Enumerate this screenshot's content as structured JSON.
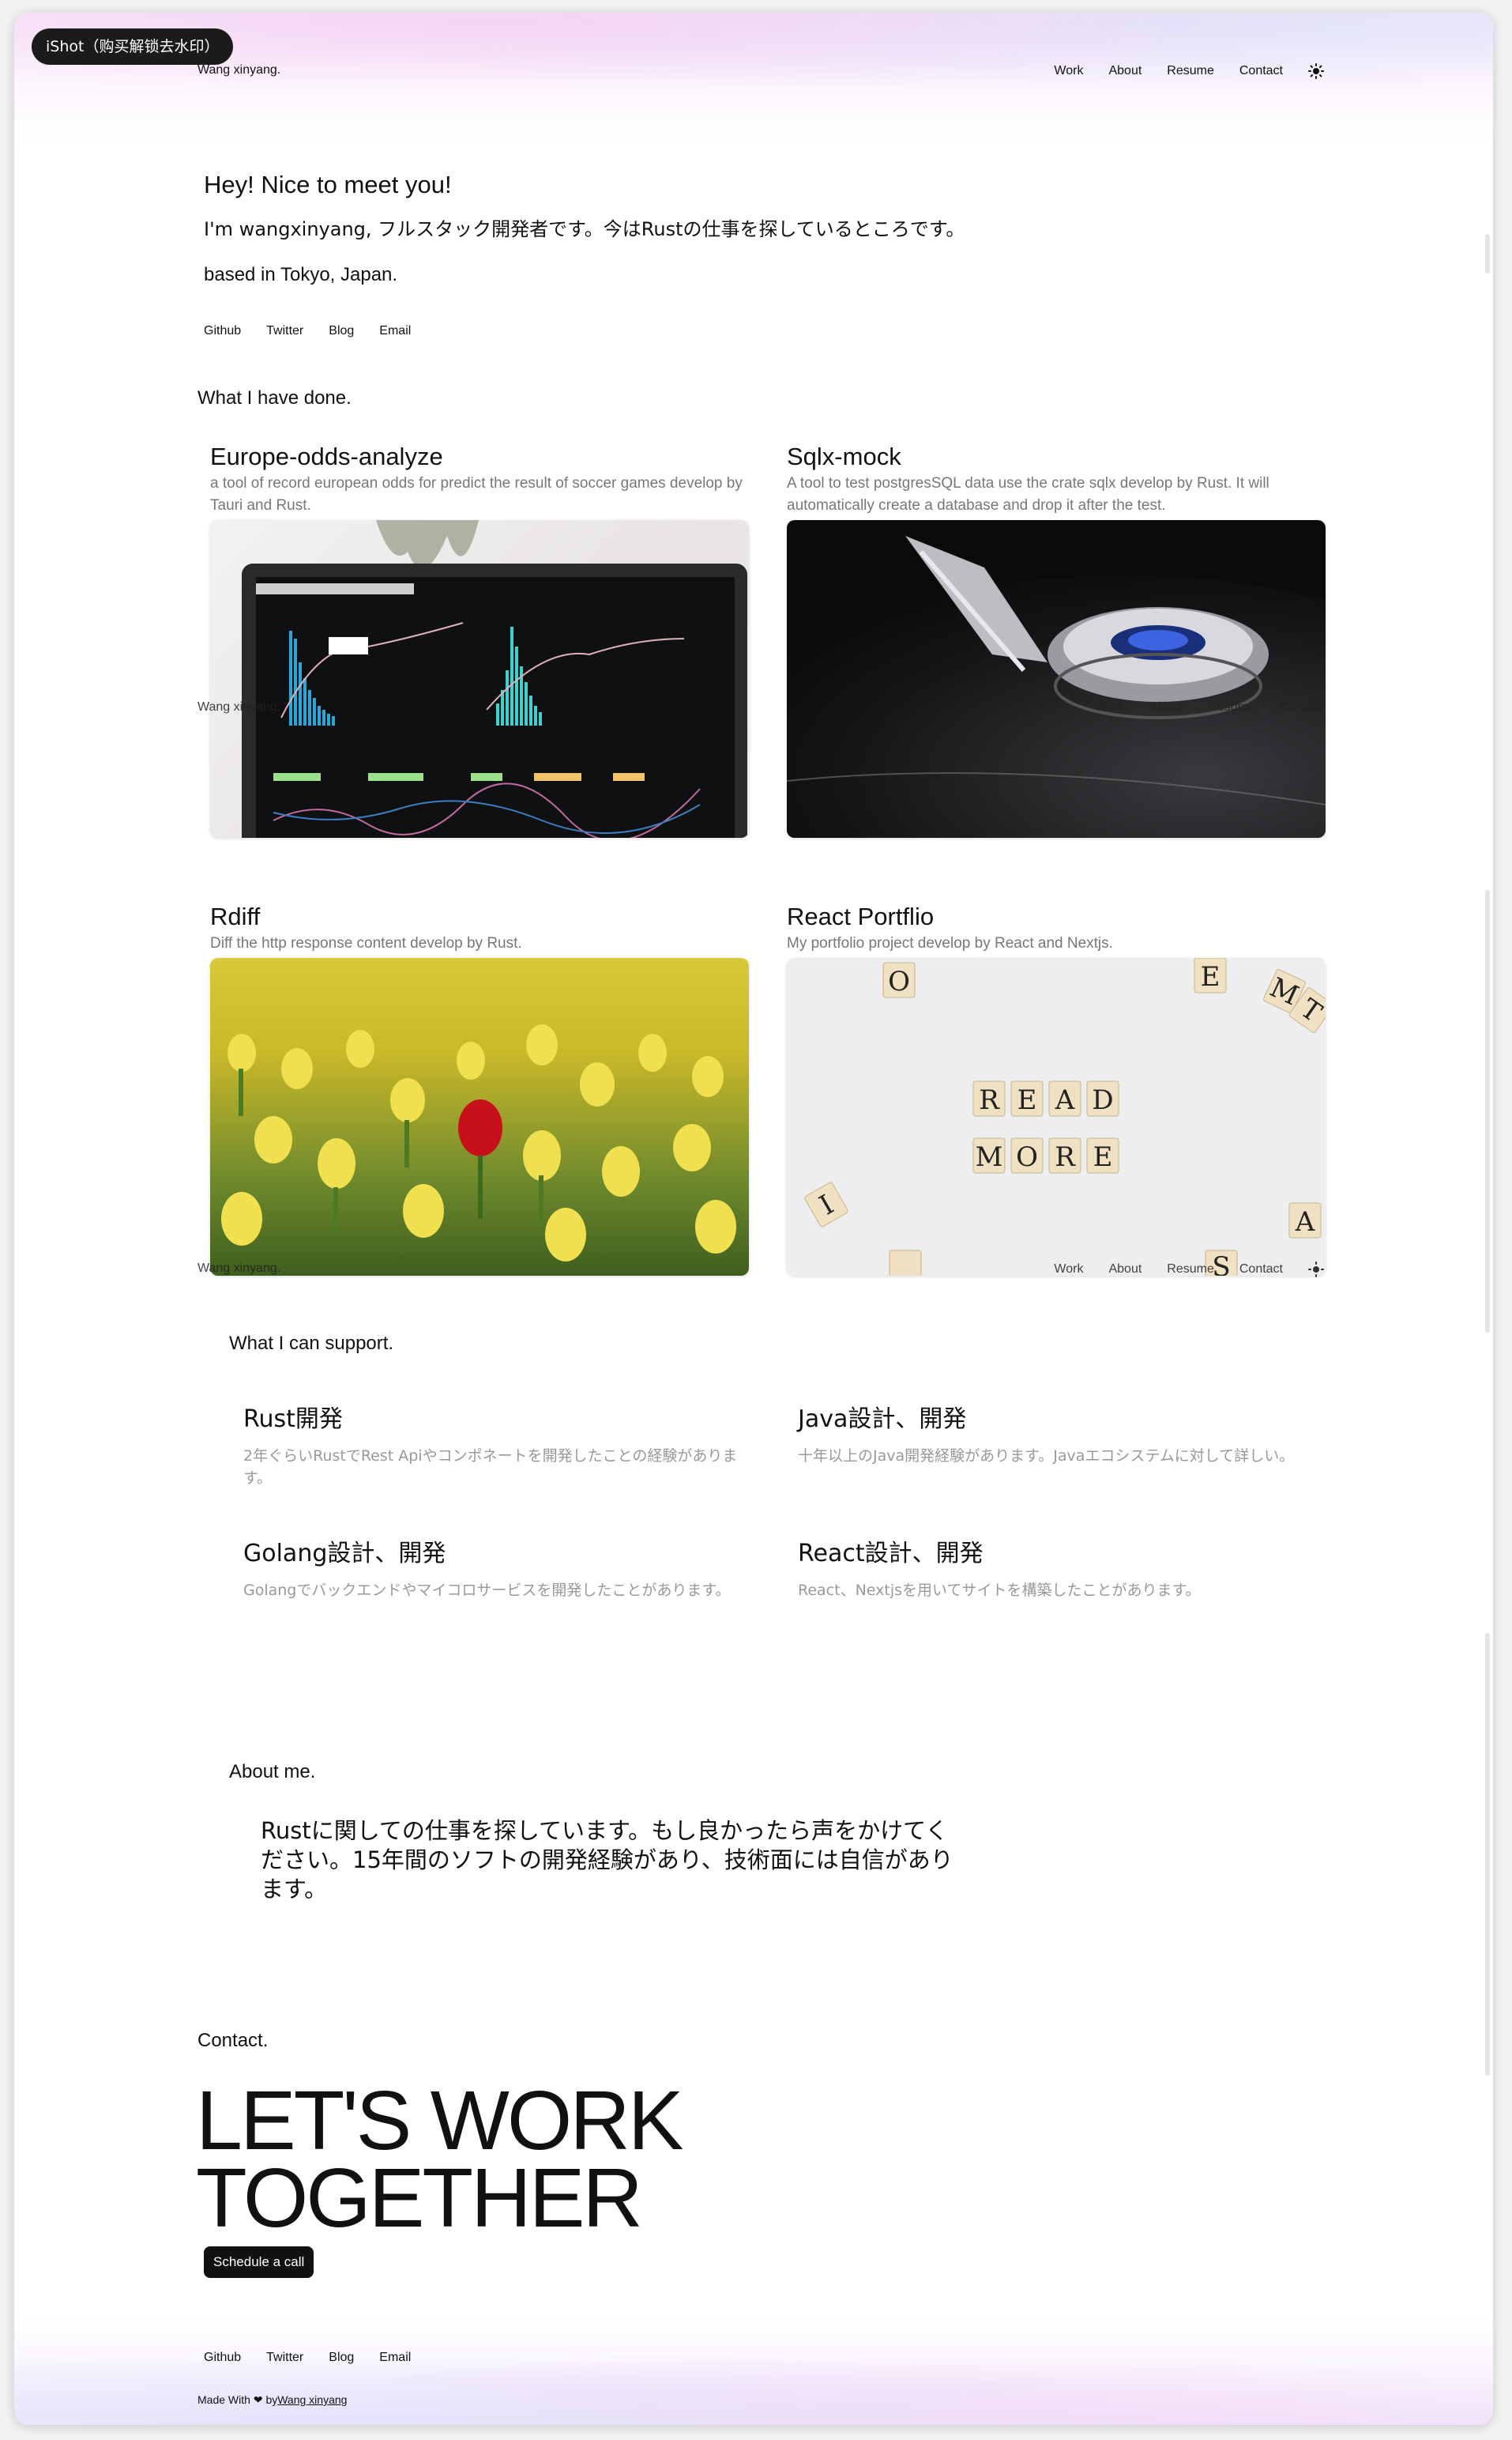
{
  "overlay": {
    "badge": "iShot（购买解锁去水印）"
  },
  "nav": {
    "brand": "Wang xinyang.",
    "links": [
      "Work",
      "About",
      "Resume",
      "Contact"
    ],
    "theme_icon": "sun-icon"
  },
  "hero": {
    "greeting": "Hey! Nice to meet you!",
    "intro": "I'm wangxinyang, フルスタック開発者です。今はRustの仕事を探しているところです。",
    "location": "based in Tokyo, Japan."
  },
  "social": [
    "Github",
    "Twitter",
    "Blog",
    "Email"
  ],
  "work": {
    "label": "What I have done.",
    "projects": [
      {
        "title": "Europe-odds-analyze",
        "description": "a tool of record european odds for predict the result of soccer games develop by Tauri and Rust.",
        "image": "analytics-dashboard-laptop"
      },
      {
        "title": "Sqlx-mock",
        "description": "A tool to test postgresSQL data use the crate sqlx develop by Rust. It will automatically create a database and drop it after the test.",
        "image": "hard-drive-platter"
      },
      {
        "title": "Rdiff",
        "description": "Diff the http response content develop by Rust.",
        "image": "tulip-field"
      },
      {
        "title": "React Portflio",
        "description": "My portfolio project develop by React and Nextjs.",
        "image": "read-more-letter-tiles"
      }
    ]
  },
  "skills": {
    "label": "What I can support.",
    "items": [
      {
        "title": "Rust開発",
        "description": "2年ぐらいRustでRest Apiやコンポネートを開発したことの経験があります。"
      },
      {
        "title": "Java設計、開発",
        "description": "十年以上のJava開発経験があります。Javaエコシステムに対して詳しい。"
      },
      {
        "title": "Golang設計、開発",
        "description": "Golangでバックエンドやマイコロサービスを開発したことがあります。"
      },
      {
        "title": "React設計、開発",
        "description": "React、Nextjsを用いてサイトを構築したことがあります。"
      }
    ]
  },
  "about": {
    "label": "About me.",
    "text": "Rustに関しての仕事を探しています。もし良かったら声をかけてください。15年間のソフトの開発経験があり、技術面には自信があります。"
  },
  "contact": {
    "label": "Contact.",
    "headline_line1": "LET'S WORK",
    "headline_line2": "TOGETHER",
    "button": "Schedule a call"
  },
  "tiles": {
    "read": [
      "R",
      "E",
      "A",
      "D"
    ],
    "more": [
      "M",
      "O",
      "R",
      "E"
    ],
    "scattered": [
      "O",
      "E",
      "M",
      "T",
      "I",
      "A",
      "S"
    ]
  },
  "footer": {
    "prefix": "Made With",
    "heart_icon": "heart-icon",
    "by": "by",
    "author": "Wang xinyang"
  },
  "colors": {
    "accent": "#111111",
    "muted_text": "#777777",
    "glow_pink": "#f7e9fa",
    "glow_lilac": "#e2e4fc"
  }
}
